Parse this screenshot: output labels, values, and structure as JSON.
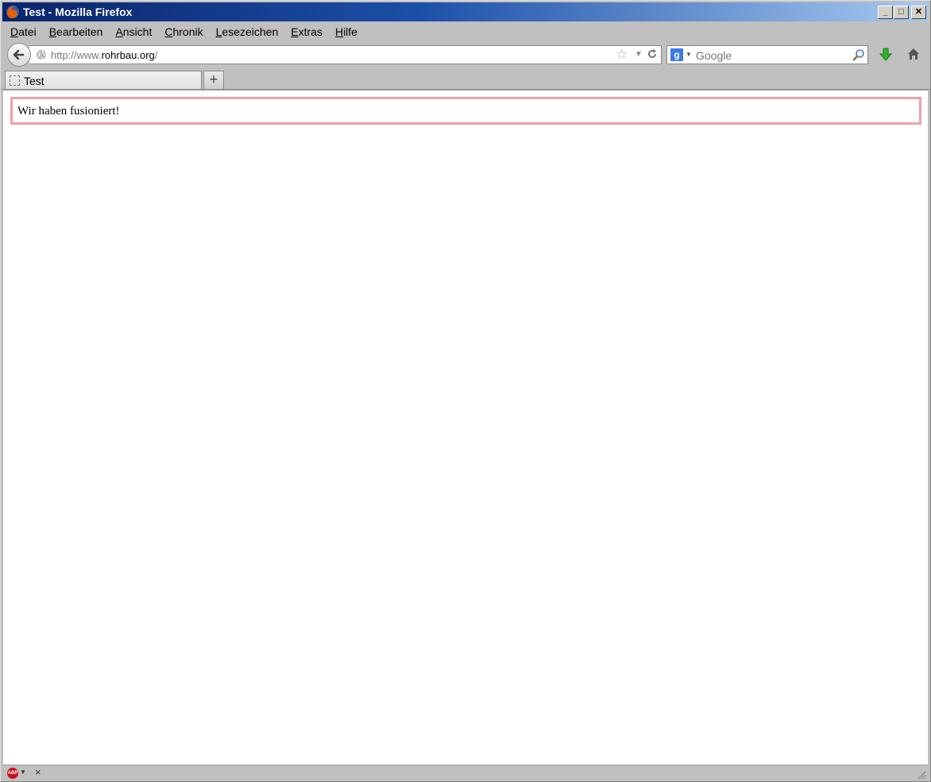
{
  "window": {
    "title": "Test - Mozilla Firefox"
  },
  "menu": [
    "Datei",
    "Bearbeiten",
    "Ansicht",
    "Chronik",
    "Lesezeichen",
    "Extras",
    "Hilfe"
  ],
  "url": {
    "prefix": "http://www.",
    "domain": "rohrbau.org",
    "suffix": "/"
  },
  "search": {
    "engine": "Google",
    "placeholder": "Google"
  },
  "tabs": [
    {
      "label": "Test"
    }
  ],
  "page": {
    "notice": "Wir haben fusioniert!"
  },
  "colors": {
    "notice_border": "#f2a0a4",
    "titlebar_start": "#0a246a",
    "titlebar_end": "#a6caf0"
  }
}
